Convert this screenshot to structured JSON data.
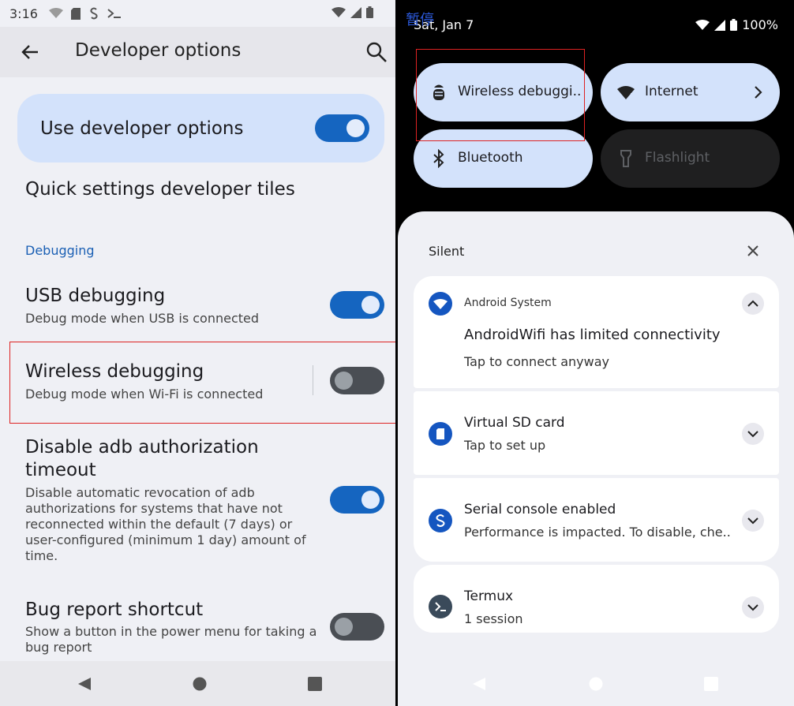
{
  "left": {
    "status": {
      "time": "3:16"
    },
    "appbar": {
      "title": "Developer options"
    },
    "dev_card": {
      "label": "Use developer options",
      "toggle": "on"
    },
    "quick_tiles": "Quick settings developer tiles",
    "section": "Debugging",
    "settings": [
      {
        "title": "USB debugging",
        "subtitle": "Debug mode when USB is connected",
        "toggle": "on"
      },
      {
        "title": "Wireless debugging",
        "subtitle": "Debug mode when Wi-Fi is connected",
        "toggle": "off"
      },
      {
        "title_line1": "Disable adb authorization",
        "title_line2": "timeout",
        "sub_lines": [
          "Disable automatic revocation of adb",
          "authorizations for systems that have not",
          "reconnected within the default (7 days) or",
          "user-configured (minimum 1 day) amount of",
          "time."
        ],
        "toggle": "on"
      },
      {
        "title": "Bug report shortcut",
        "sub_lines": [
          "Show a button in the power menu for taking a",
          "bug report"
        ],
        "toggle": "off"
      }
    ]
  },
  "right": {
    "watermark": "暂停",
    "date": "Sat, Jan 7",
    "battery": "100%",
    "tiles": [
      {
        "label": "Wireless debuggi..",
        "icon": "android-debug-icon",
        "state": "on"
      },
      {
        "label": "Internet",
        "icon": "wifi-warning-icon",
        "state": "on"
      },
      {
        "label": "Bluetooth",
        "icon": "bluetooth-icon",
        "state": "on"
      },
      {
        "label": "Flashlight",
        "icon": "flashlight-icon",
        "state": "off"
      }
    ],
    "shade": {
      "header": "Silent",
      "notifications": [
        {
          "app": "Android System",
          "title": "AndroidWifi has limited connectivity",
          "text": "Tap to connect anyway"
        },
        {
          "title": "Virtual SD card",
          "text": "Tap to set up"
        },
        {
          "title": "Serial console enabled",
          "text": "Performance is impacted. To disable, che.."
        },
        {
          "title": "Termux",
          "text": "1 session"
        }
      ]
    }
  },
  "colors": {
    "accent": "#1565c0",
    "card_bg": "#d3e2fb",
    "highlight_box": "#dd2222",
    "panel_bg": "#eff0f5"
  }
}
